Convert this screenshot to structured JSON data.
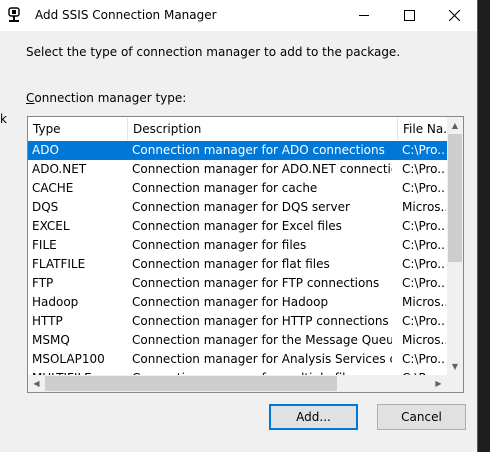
{
  "window": {
    "title": "Add SSIS Connection Manager",
    "controls": [
      "minimize-icon",
      "maximize-icon",
      "close-icon"
    ]
  },
  "background_fragment": "k",
  "instruction": "Select the type of connection manager to add to the package.",
  "list_label": {
    "prefix": "C",
    "rest": "onnection manager type:"
  },
  "columns": [
    "Type",
    "Description",
    "File Na..."
  ],
  "rows": [
    {
      "type": "ADO",
      "description": "Connection manager for ADO connections",
      "file": "C:\\Pro...",
      "selected": true
    },
    {
      "type": "ADO.NET",
      "description": "Connection manager for ADO.NET connections",
      "file": "C:\\Pro..."
    },
    {
      "type": "CACHE",
      "description": "Connection manager for cache",
      "file": "C:\\Pro..."
    },
    {
      "type": "DQS",
      "description": "Connection manager for DQS server",
      "file": "Micros..."
    },
    {
      "type": "EXCEL",
      "description": "Connection manager for Excel files",
      "file": "C:\\Pro..."
    },
    {
      "type": "FILE",
      "description": "Connection manager for files",
      "file": "C:\\Pro..."
    },
    {
      "type": "FLATFILE",
      "description": "Connection manager for flat files",
      "file": "C:\\Pro..."
    },
    {
      "type": "FTP",
      "description": "Connection manager for FTP connections",
      "file": "C:\\Pro..."
    },
    {
      "type": "Hadoop",
      "description": "Connection manager for Hadoop",
      "file": "Micros..."
    },
    {
      "type": "HTTP",
      "description": "Connection manager for HTTP connections",
      "file": "C:\\Pro..."
    },
    {
      "type": "MSMQ",
      "description": "Connection manager for the Message Queue t...",
      "file": "Micros..."
    },
    {
      "type": "MSOLAP100",
      "description": "Connection manager for Analysis Services con...",
      "file": "C:\\Pro..."
    },
    {
      "type": "MULTIFILE",
      "description": "Connection manager for multiple files",
      "file": "C:\\Pro..."
    }
  ],
  "buttons": {
    "add": "Add...",
    "cancel": "Cancel"
  },
  "colors": {
    "selection": "#0078d7",
    "dialog_bg": "#f0f0f0"
  }
}
